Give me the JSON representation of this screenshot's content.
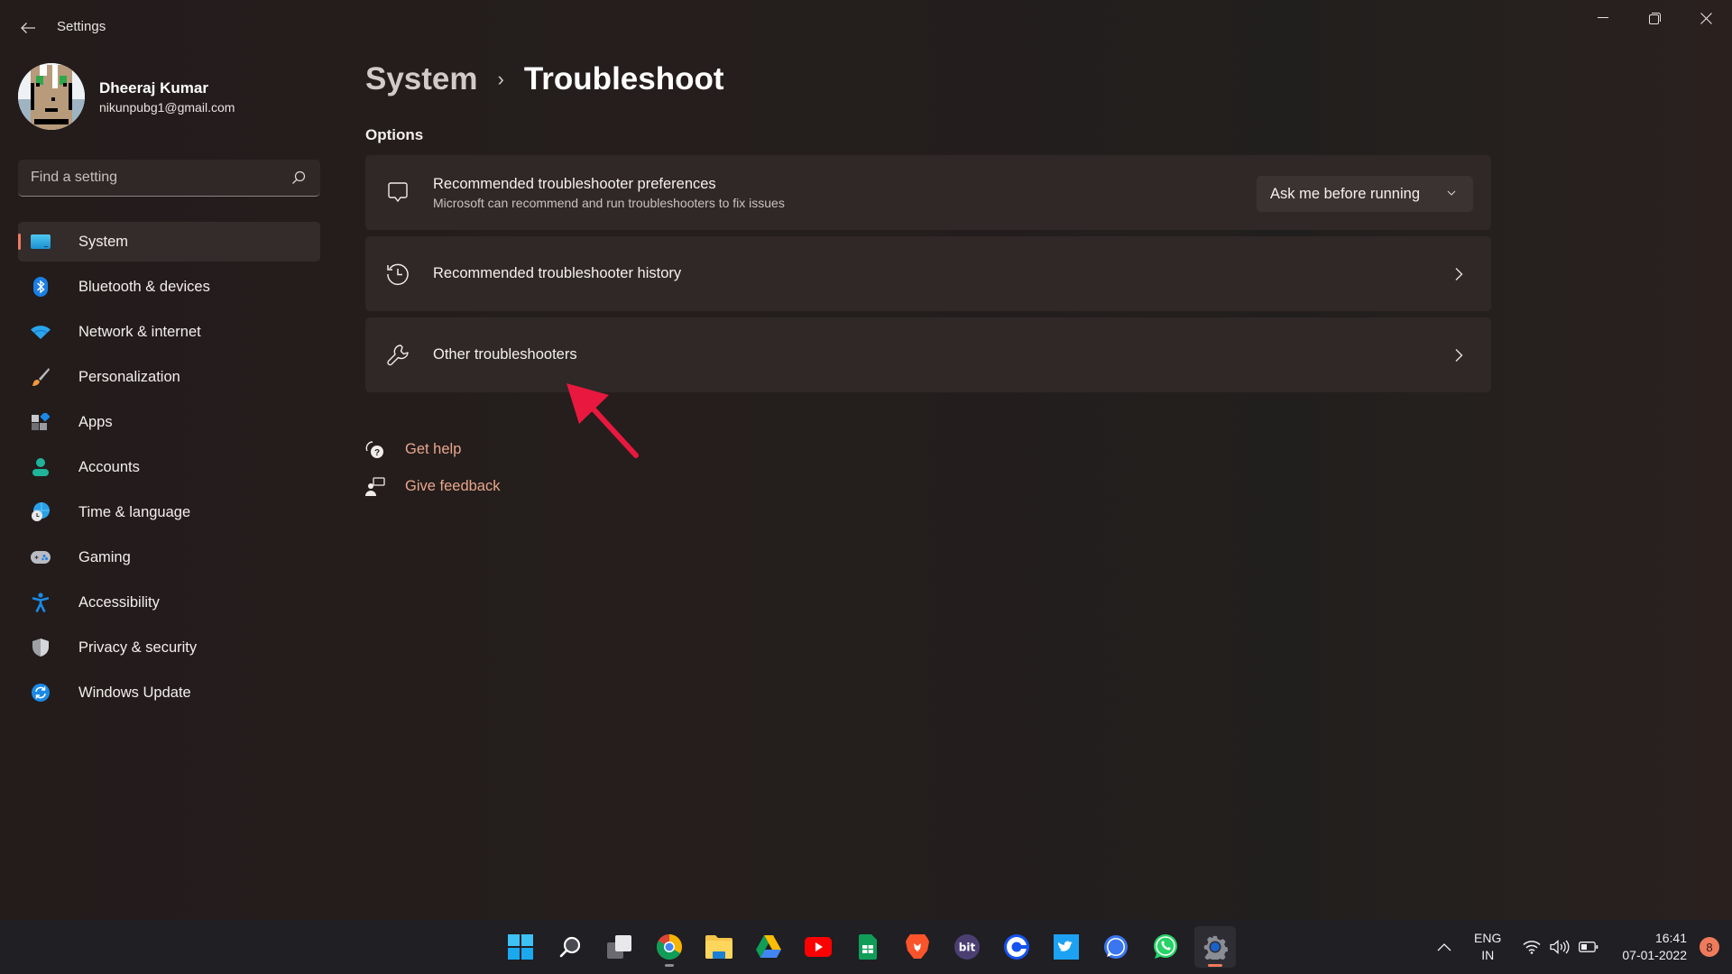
{
  "window": {
    "app_title": "Settings",
    "controls": {
      "minimize": "minimize-icon",
      "maximize": "restore-icon",
      "close": "close-icon"
    }
  },
  "profile": {
    "name": "Dheeraj Kumar",
    "email": "nikunpubg1@gmail.com"
  },
  "search": {
    "placeholder": "Find a setting",
    "value": ""
  },
  "sidebar": {
    "items": [
      {
        "label": "System",
        "icon": "system-icon",
        "active": true
      },
      {
        "label": "Bluetooth & devices",
        "icon": "bluetooth-icon"
      },
      {
        "label": "Network & internet",
        "icon": "wifi-icon"
      },
      {
        "label": "Personalization",
        "icon": "brush-icon"
      },
      {
        "label": "Apps",
        "icon": "apps-icon"
      },
      {
        "label": "Accounts",
        "icon": "person-icon"
      },
      {
        "label": "Time & language",
        "icon": "globe-clock-icon"
      },
      {
        "label": "Gaming",
        "icon": "gamepad-icon"
      },
      {
        "label": "Accessibility",
        "icon": "accessibility-icon"
      },
      {
        "label": "Privacy & security",
        "icon": "shield-icon"
      },
      {
        "label": "Windows Update",
        "icon": "update-icon"
      }
    ]
  },
  "main": {
    "breadcrumb": {
      "parent": "System",
      "separator": "›",
      "current": "Troubleshoot"
    },
    "section_title": "Options",
    "cards": [
      {
        "title": "Recommended troubleshooter preferences",
        "subtitle": "Microsoft can recommend and run troubleshooters to fix issues",
        "icon": "chat-bubble-icon",
        "dropdown_value": "Ask me before running"
      },
      {
        "title": "Recommended troubleshooter history",
        "icon": "history-icon"
      },
      {
        "title": "Other troubleshooters",
        "icon": "wrench-icon"
      }
    ],
    "help_links": [
      {
        "label": "Get help",
        "icon": "help-icon"
      },
      {
        "label": "Give feedback",
        "icon": "feedback-icon"
      }
    ]
  },
  "colors": {
    "accent": "#ef7a5c",
    "link": "#e8a68b",
    "annotation_arrow": "#e8183f"
  },
  "taskbar": {
    "apps": [
      "start-icon",
      "search-icon",
      "task-view-icon",
      "chrome-icon",
      "file-explorer-icon",
      "google-drive-icon",
      "youtube-icon",
      "google-sheets-icon",
      "brave-icon",
      "bit-icon",
      "coinbase-icon",
      "twitter-icon",
      "signal-icon",
      "whatsapp-icon",
      "settings-icon"
    ],
    "language": {
      "line1": "ENG",
      "line2": "IN"
    },
    "time": "16:41",
    "date": "07-01-2022",
    "notification_count": "8"
  }
}
